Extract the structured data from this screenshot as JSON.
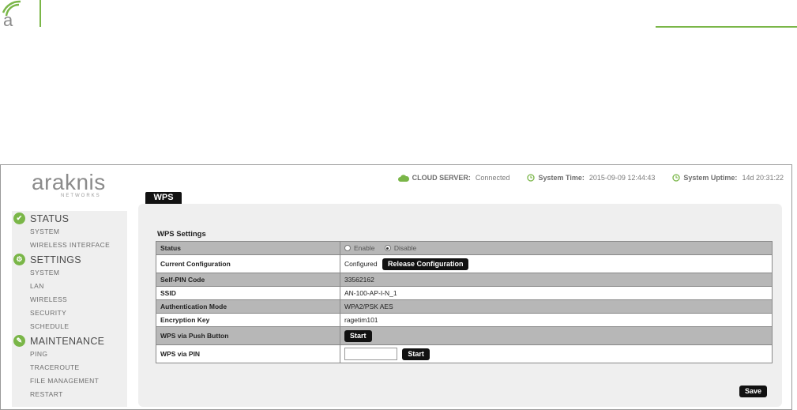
{
  "doc": {
    "logo_glyph": "a"
  },
  "brand": {
    "name": "araknis",
    "sub": "NETWORKS"
  },
  "topbar": {
    "cloud_label": "CLOUD SERVER:",
    "cloud_value": "Connected",
    "time_label": "System Time:",
    "time_value": "2015-09-09 12:44:43",
    "uptime_label": "System Uptime:",
    "uptime_value": "14d 20:31:22"
  },
  "tab": {
    "label": "WPS"
  },
  "sidebar": {
    "status": {
      "label": "STATUS",
      "items": [
        "SYSTEM",
        "WIRELESS INTERFACE"
      ]
    },
    "settings": {
      "label": "SETTINGS",
      "items": [
        "SYSTEM",
        "LAN",
        "WIRELESS",
        "SECURITY",
        "SCHEDULE"
      ]
    },
    "maintenance": {
      "label": "MAINTENANCE",
      "items": [
        "PING",
        "TRACEROUTE",
        "FILE MANAGEMENT",
        "RESTART"
      ]
    }
  },
  "wps": {
    "title": "WPS Settings",
    "status_label": "Status",
    "enable_label": "Enable",
    "disable_label": "Disable",
    "current_config_label": "Current Configuration",
    "current_config_value": "Configured",
    "release_button": "Release Configuration",
    "self_pin_label": "Self-PIN Code",
    "self_pin_value": "33562162",
    "ssid_label": "SSID",
    "ssid_value": "AN-100-AP-I-N_1",
    "auth_label": "Authentication Mode",
    "auth_value": "WPA2/PSK AES",
    "enc_label": "Encryption Key",
    "enc_value": "ragetim101",
    "push_label": "WPS via Push Button",
    "push_button": "Start",
    "pin_label": "WPS via PIN",
    "pin_value": "",
    "pin_button": "Start",
    "save_button": "Save"
  },
  "colors": {
    "accent": "#7ab648",
    "button": "#111111",
    "row_gray": "#b7b7b7"
  }
}
